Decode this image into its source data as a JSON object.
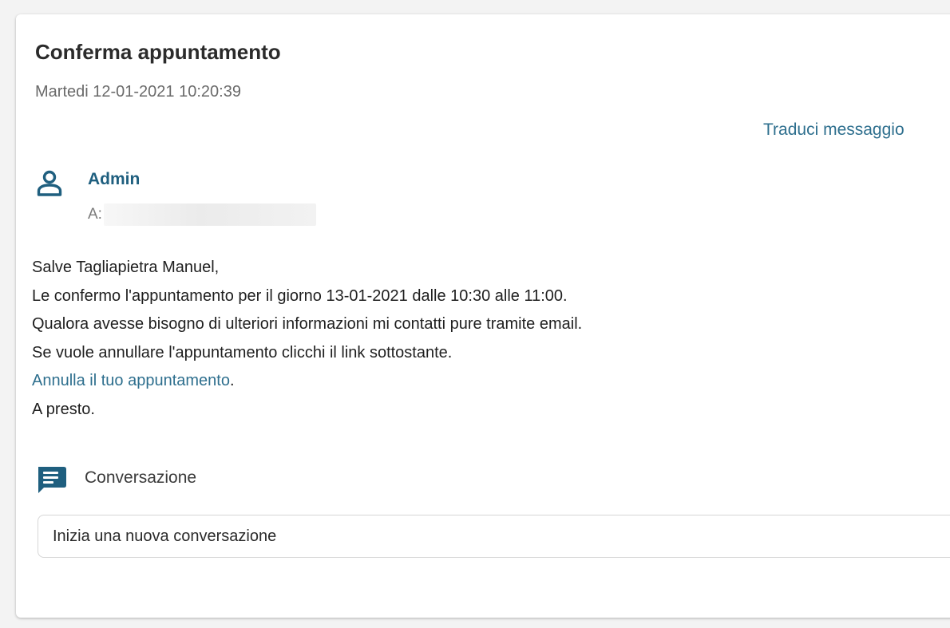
{
  "message": {
    "title": "Conferma appuntamento",
    "date": "Martedi 12-01-2021 10:20:39",
    "translate_label": "Traduci messaggio",
    "sender": {
      "icon": "user-icon",
      "name": "Admin",
      "recipient_label": "A:"
    },
    "body": {
      "greeting": "Salve Tagliapietra Manuel,",
      "line1": "Le confermo l'appuntamento per il giorno 13-01-2021 dalle 10:30 alle 11:00.",
      "line2": "Qualora avesse bisogno di ulteriori informazioni mi contatti pure tramite email.",
      "line3": "Se vuole annullare l'appuntamento clicchi il link sottostante.",
      "cancel_link": "Annulla il tuo appuntamento",
      "cancel_link_suffix": ".",
      "closing": "A presto."
    }
  },
  "conversation": {
    "icon": "chat-icon",
    "label": "Conversazione",
    "placeholder": "Inizia una nuova conversazione"
  },
  "colors": {
    "link": "#2e6f8e",
    "sender": "#1f5f7f",
    "icon": "#1f5f7f"
  }
}
